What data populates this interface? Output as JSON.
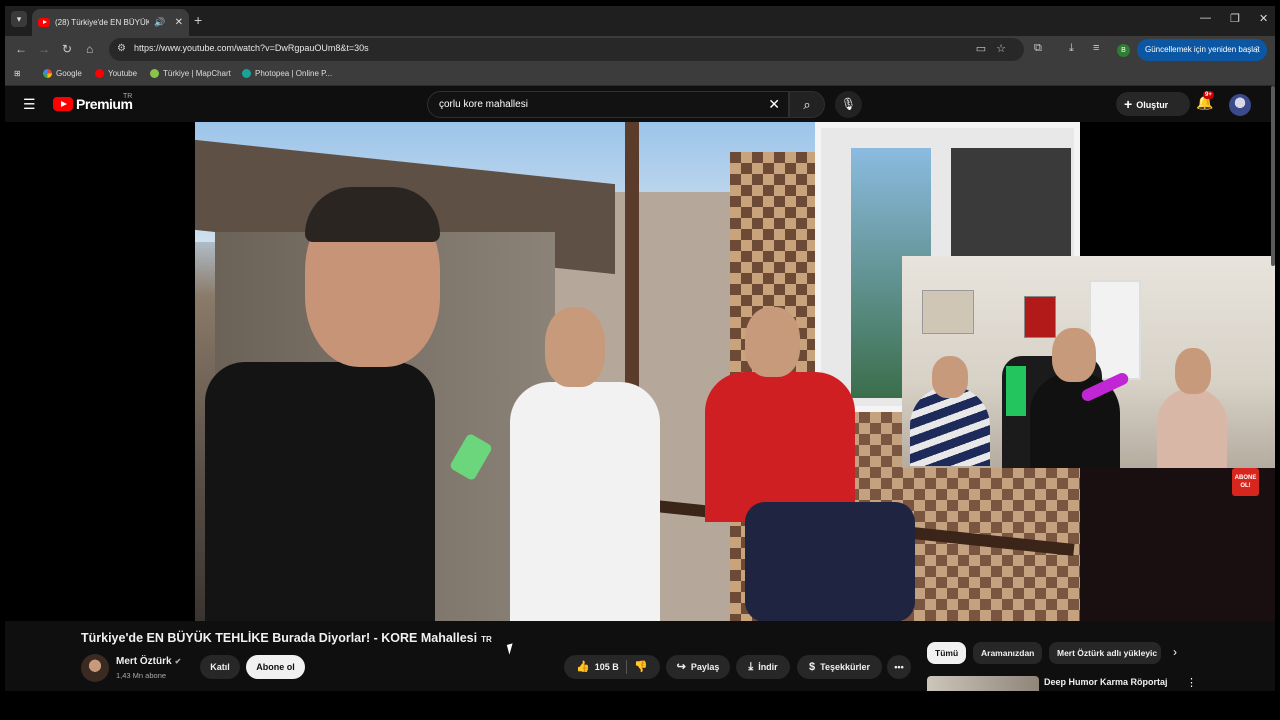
{
  "browser": {
    "tab_title": "(28) Türkiye'de EN BÜYÜK T",
    "url": "https://www.youtube.com/watch?v=DwRgpauOUm8&t=30s",
    "update_button": "Güncellemek için yeniden başlat",
    "profile_initial": "B",
    "bookmarks": [
      "Google",
      "Youtube",
      "Türkiye | MapChart",
      "Photopea | Online P..."
    ]
  },
  "youtube": {
    "logo_text": "Premium",
    "region": "TR",
    "search_query": "çorlu kore mahallesi",
    "create_label": "Oluştur",
    "notification_count": "9+"
  },
  "overlay": {
    "abone_label": "ABONE OL!"
  },
  "video": {
    "title": "Türkiye'de EN BÜYÜK TEHLİKE Burada Diyorlar! - KORE Mahallesi",
    "title_badge": "TR",
    "channel_name": "Mert Öztürk",
    "subscribers": "1,43 Mn abone",
    "join_label": "Katıl",
    "subscribe_label": "Abone ol",
    "likes": "105 B",
    "share_label": "Paylaş",
    "download_label": "İndir",
    "thanks_label": "Teşekkürler"
  },
  "sidebar": {
    "chips": [
      "Tümü",
      "Aramanızdan",
      "Mert Öztürk adlı yükleyic"
    ],
    "suggestion_title": "Deep Humor Karma Röportaj"
  },
  "colors": {
    "accent_red": "#ff0000",
    "update_blue": "#0b57a3",
    "background": "#0f0f0f"
  }
}
